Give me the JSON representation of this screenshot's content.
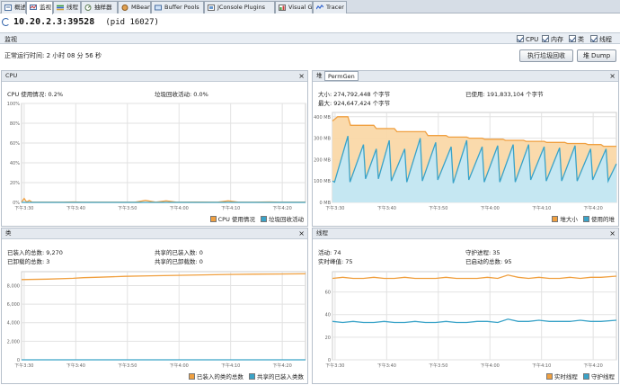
{
  "tabs": [
    {
      "label": "概述",
      "icon": "overview-icon",
      "active": false
    },
    {
      "label": "监视",
      "icon": "monitor-icon",
      "active": true
    },
    {
      "label": "线程",
      "icon": "threads-icon",
      "active": false
    },
    {
      "label": "抽样器",
      "icon": "sampler-icon",
      "active": false
    },
    {
      "label": "MBeans",
      "icon": "mbeans-icon",
      "active": false
    },
    {
      "label": "Buffer Pools",
      "icon": "buffer-pools-icon",
      "active": false
    },
    {
      "label": "JConsole Plugins",
      "icon": "jconsole-plugins-icon",
      "active": false
    },
    {
      "label": "Visual GC",
      "icon": "visual-gc-icon",
      "active": false
    },
    {
      "label": "Tracer",
      "icon": "tracer-icon",
      "active": false
    }
  ],
  "header": {
    "title": "10.20.2.3:39528",
    "pid": "(pid 16027)"
  },
  "monitor": {
    "label": "监视",
    "checkboxes": [
      {
        "label": "CPU",
        "checked": true
      },
      {
        "label": "内存",
        "checked": true
      },
      {
        "label": "类",
        "checked": true
      },
      {
        "label": "线程",
        "checked": true
      }
    ]
  },
  "uptime": "正常运行时间: 2 小时 08 分 56 秒",
  "buttons": {
    "gc": "执行垃圾回收",
    "dump": "堆 Dump"
  },
  "panels": {
    "cpu": {
      "title": "CPU",
      "stats": [
        "CPU 使用情况: 0.2%",
        "垃圾回收活动: 0.0%"
      ],
      "legend": [
        "CPU 使用情况",
        "垃圾回收活动"
      ]
    },
    "heap": {
      "title": "堆",
      "selector": "PermGen",
      "stats": [
        "大小: 274,792,448 个字节",
        "已使用: 191,833,104 个字节",
        "最大: 924,647,424 个字节"
      ],
      "legend": [
        "堆大小",
        "使用的堆"
      ]
    },
    "classes": {
      "title": "类",
      "stats": [
        "已装入的总数: 9,270",
        "共享的已装入数: 0",
        "已卸载的总数: 3",
        "共享的已卸载数: 0"
      ],
      "legend": [
        "已装入的类的总数",
        "共享的已装入类数"
      ]
    },
    "threads": {
      "title": "线程",
      "stats": [
        "活动: 74",
        "守护进程: 35",
        "实时峰值: 75",
        "已启动的总数: 95"
      ],
      "legend": [
        "实时线程",
        "守护线程"
      ]
    }
  },
  "colors": {
    "orange": "#f0a040",
    "orange_fill": "#fad8a8",
    "blue": "#3aa3c8",
    "blue_fill": "#c2e8f6",
    "grid": "#e2e2e2"
  },
  "chart_data": [
    {
      "type": "area",
      "title": "CPU",
      "categories": [
        "下午3:30",
        "下午3:40",
        "下午3:50",
        "下午4:00",
        "下午4:10",
        "下午4:20"
      ],
      "y_ticks": [
        "0%",
        "20%",
        "40%",
        "60%",
        "80%",
        "100%"
      ],
      "ylim": [
        0,
        100
      ],
      "xlim": [
        0,
        55
      ],
      "series": [
        {
          "name": "CPU 使用情况",
          "color": "#f0a040",
          "x": [
            0,
            0.5,
            1,
            1.5,
            2,
            3,
            5,
            8,
            10,
            12,
            14,
            16,
            20,
            22,
            24,
            26,
            28,
            30,
            34,
            38,
            40,
            42,
            45,
            48,
            50,
            53,
            55
          ],
          "y": [
            0.3,
            4,
            0.3,
            2,
            0.3,
            0.2,
            0.2,
            0.2,
            0.5,
            0.2,
            0.2,
            0.2,
            0.2,
            0.2,
            2,
            0.2,
            1.5,
            0.2,
            0.3,
            0.2,
            1.5,
            0.2,
            0.2,
            0.5,
            0.2,
            0.2,
            0.2
          ]
        },
        {
          "name": "垃圾回收活动",
          "color": "#3aa3c8",
          "x": [
            0,
            55
          ],
          "y": [
            0,
            0
          ]
        }
      ]
    },
    {
      "type": "area",
      "title": "堆",
      "categories": [
        "下午3:30",
        "下午3:40",
        "下午3:50",
        "下午4:00",
        "下午4:10",
        "下午4:20"
      ],
      "y_ticks": [
        "0 MB",
        "100 MB",
        "200 MB",
        "300 MB",
        "400 MB"
      ],
      "ylim": [
        0,
        420
      ],
      "xlim": [
        0,
        55
      ],
      "series": [
        {
          "name": "堆大小",
          "color": "#f0a040",
          "x": [
            0,
            0.5,
            1,
            3,
            3.5,
            8,
            8.5,
            12,
            12.5,
            18,
            18.5,
            22,
            22.5,
            26,
            26.5,
            29,
            29.5,
            33,
            33.5,
            37,
            37.5,
            41,
            41.5,
            45,
            45.5,
            49,
            49.5,
            52,
            52.5,
            55
          ],
          "y": [
            380,
            390,
            400,
            400,
            360,
            360,
            345,
            345,
            330,
            330,
            312,
            312,
            305,
            305,
            300,
            300,
            295,
            295,
            290,
            290,
            285,
            285,
            280,
            280,
            275,
            275,
            270,
            270,
            262,
            262
          ]
        },
        {
          "name": "使用的堆",
          "color": "#3aa3c8",
          "x": [
            0,
            0.4,
            3,
            3.4,
            6,
            6.4,
            8.5,
            8.9,
            11,
            11.4,
            14,
            14.4,
            17,
            17.4,
            20,
            20.4,
            23,
            23.4,
            26,
            26.4,
            29,
            29.4,
            32,
            32.4,
            35,
            35.4,
            38,
            38.4,
            41,
            41.4,
            44,
            44.4,
            47,
            47.4,
            50,
            50.4,
            53,
            53.4,
            55
          ],
          "y": [
            100,
            95,
            310,
            95,
            270,
            110,
            250,
            110,
            290,
            100,
            250,
            95,
            300,
            100,
            280,
            105,
            260,
            90,
            290,
            105,
            260,
            95,
            265,
            95,
            270,
            95,
            270,
            105,
            260,
            100,
            255,
            100,
            265,
            100,
            250,
            105,
            250,
            100,
            180
          ]
        }
      ]
    },
    {
      "type": "line",
      "title": "类",
      "categories": [
        "下午3:30",
        "下午3:40",
        "下午3:50",
        "下午4:00",
        "下午4:10",
        "下午4:20"
      ],
      "y_ticks": [
        "0",
        "2,000",
        "4,000",
        "6,000",
        "8,000"
      ],
      "ylim": [
        0,
        9500
      ],
      "xlim": [
        0,
        55
      ],
      "series": [
        {
          "name": "已装入的类的总数",
          "color": "#f0a040",
          "x": [
            0,
            5,
            10,
            12,
            15,
            20,
            25,
            30,
            35,
            40,
            45,
            50,
            55
          ],
          "y": [
            8650,
            8700,
            8780,
            8850,
            8900,
            9000,
            9050,
            9100,
            9150,
            9200,
            9230,
            9250,
            9270
          ]
        },
        {
          "name": "共享的已装入类数",
          "color": "#3aa3c8",
          "x": [
            0,
            55
          ],
          "y": [
            0,
            0
          ]
        }
      ]
    },
    {
      "type": "line",
      "title": "线程",
      "categories": [
        "下午3:30",
        "下午3:40",
        "下午3:50",
        "下午4:00",
        "下午4:10",
        "下午4:20"
      ],
      "y_ticks": [
        "0",
        "20",
        "40",
        "60"
      ],
      "ylim": [
        0,
        78
      ],
      "xlim": [
        0,
        55
      ],
      "series": [
        {
          "name": "实时线程",
          "color": "#f0a040",
          "x": [
            0,
            2,
            4,
            6,
            8,
            10,
            12,
            14,
            16,
            18,
            20,
            22,
            24,
            26,
            28,
            30,
            32,
            34,
            36,
            38,
            40,
            42,
            44,
            46,
            48,
            50,
            52,
            55
          ],
          "y": [
            72,
            73,
            72,
            72,
            73,
            72,
            72,
            73,
            72,
            72,
            72,
            73,
            72,
            72,
            72,
            73,
            72,
            75,
            73,
            72,
            73,
            72,
            72,
            73,
            72,
            73,
            73,
            74
          ]
        },
        {
          "name": "守护线程",
          "color": "#3aa3c8",
          "x": [
            0,
            2,
            4,
            6,
            8,
            10,
            12,
            14,
            16,
            18,
            20,
            22,
            24,
            26,
            28,
            30,
            32,
            34,
            36,
            38,
            40,
            42,
            44,
            46,
            48,
            50,
            52,
            55
          ],
          "y": [
            34,
            33,
            34,
            33,
            33,
            34,
            33,
            33,
            34,
            33,
            33,
            34,
            33,
            33,
            34,
            34,
            33,
            36,
            34,
            34,
            35,
            34,
            34,
            34,
            35,
            34,
            34,
            35
          ]
        }
      ]
    }
  ]
}
